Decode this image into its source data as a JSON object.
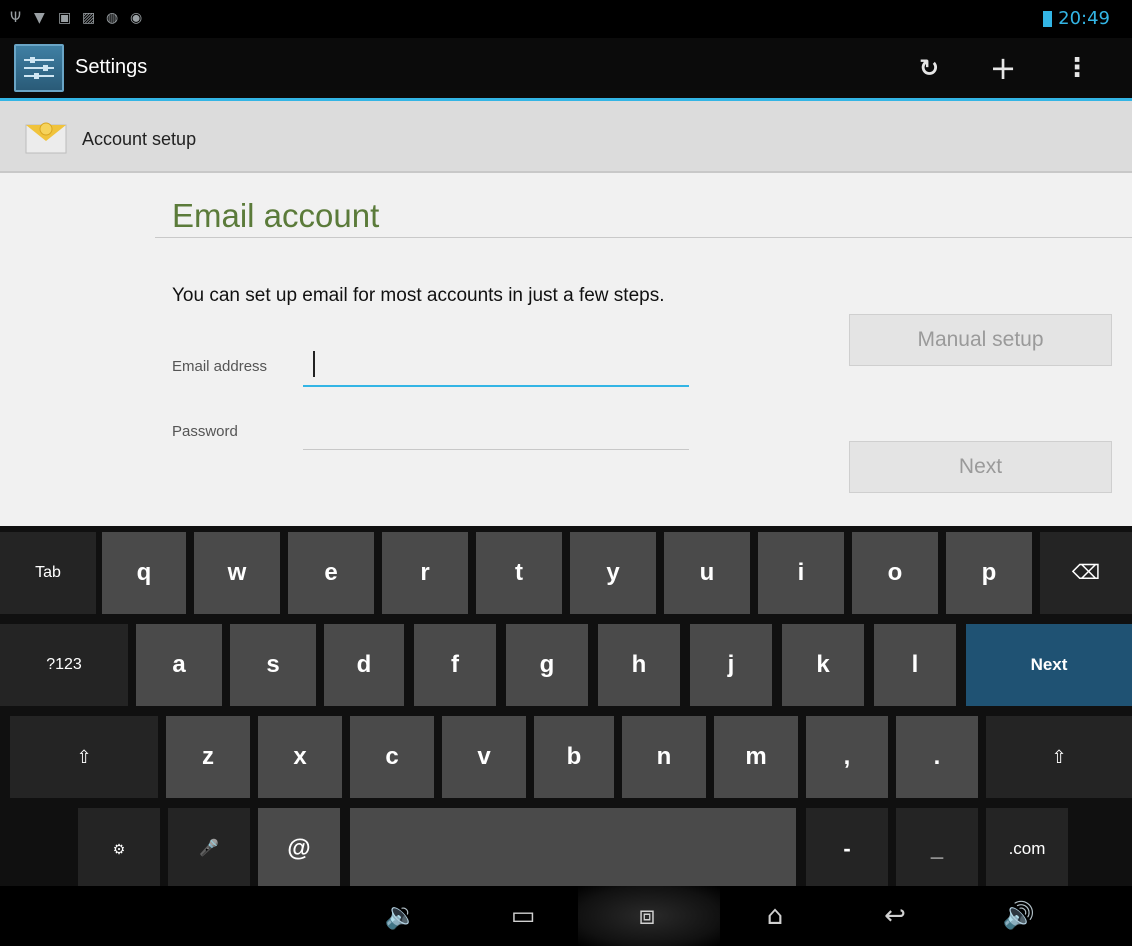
{
  "status_bar": {
    "time": "20:49",
    "icons": [
      "usb-icon",
      "wifi-icon",
      "notification-icon",
      "image-icon",
      "sync-icon",
      "controller-icon"
    ]
  },
  "action_bar": {
    "app_title": "Settings",
    "app_icon": "settings-sliders-icon",
    "actions": [
      "sync-icon",
      "add-icon",
      "overflow-menu-icon"
    ]
  },
  "subheader": {
    "title": "Account setup",
    "icon": "email-envelope-icon"
  },
  "form": {
    "section_title": "Email account",
    "intro": "You can set up email for most accounts in just a few steps.",
    "email_label": "Email address",
    "email_value": "",
    "password_label": "Password",
    "password_value": "",
    "manual_setup_label": "Manual setup",
    "next_label": "Next"
  },
  "keyboard": {
    "row1": [
      "Tab",
      "q",
      "w",
      "e",
      "r",
      "t",
      "y",
      "u",
      "i",
      "o",
      "p"
    ],
    "row2": [
      "?123",
      "a",
      "s",
      "d",
      "f",
      "g",
      "h",
      "j",
      "k",
      "l",
      "Next"
    ],
    "row3": [
      "z",
      "x",
      "c",
      "v",
      "b",
      "n",
      "m",
      ",",
      "."
    ],
    "row4": [
      "@",
      "-",
      "_",
      ".com"
    ]
  },
  "nav_bar": [
    "volume-down-icon",
    "back-icon",
    "recent-apps-icon",
    "screenshot-icon",
    "home-icon",
    "volume-up-icon"
  ]
}
